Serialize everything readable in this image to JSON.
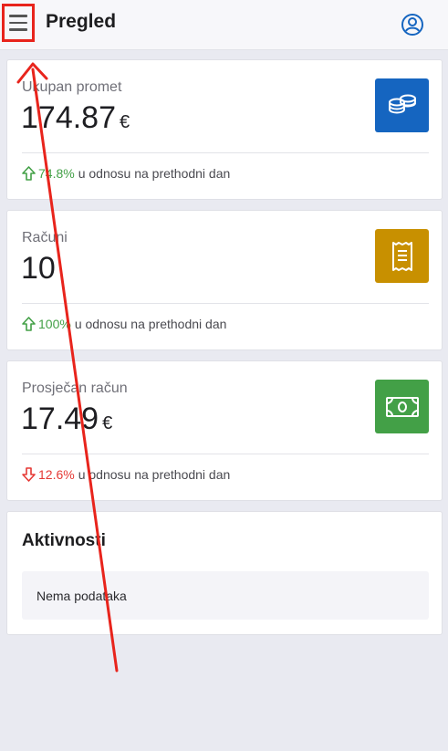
{
  "header": {
    "title": "Pregled",
    "menu_icon": "hamburger-menu-icon",
    "account_icon": "user-circle-icon"
  },
  "cards": [
    {
      "label": "Ukupan promet",
      "value": "174.87",
      "currency": "€",
      "icon": "coins-icon",
      "icon_color": "#1565c0",
      "trend": "up",
      "change_pct": "74.8%",
      "change_text": "u odnosu na prethodni dan"
    },
    {
      "label": "Računi",
      "value": "10",
      "currency": "",
      "icon": "receipt-icon",
      "icon_color": "#c89000",
      "trend": "up",
      "change_pct": "100%",
      "change_text": "u odnosu na prethodni dan"
    },
    {
      "label": "Prosječan račun",
      "value": "17.49",
      "currency": "€",
      "icon": "banknote-icon",
      "icon_color": "#43a047",
      "trend": "down",
      "change_pct": "12.6%",
      "change_text": "u odnosu na prethodni dan"
    }
  ],
  "activities": {
    "title": "Aktivnosti",
    "empty_text": "Nema podataka"
  },
  "colors": {
    "up": "#43a047",
    "down": "#e53935",
    "annotation": "#e8241c"
  }
}
